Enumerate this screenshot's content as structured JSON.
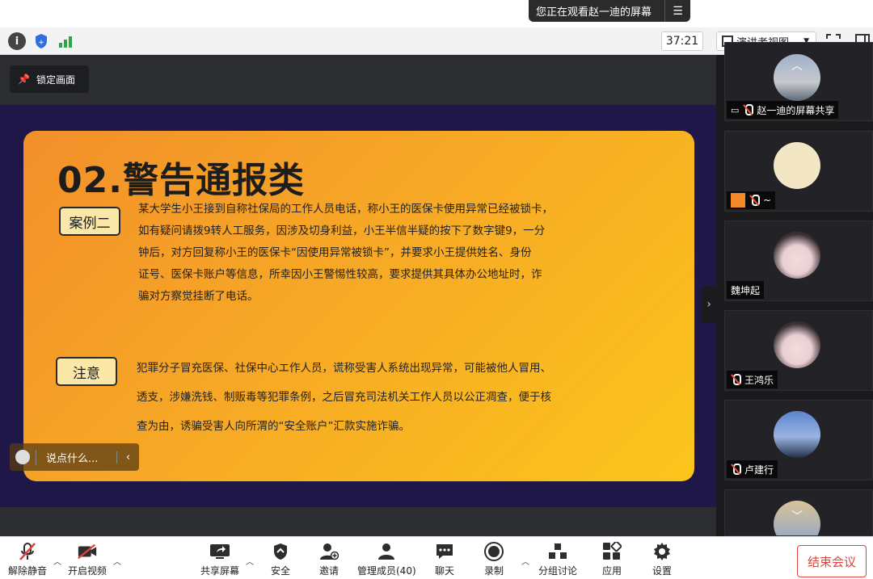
{
  "banner": {
    "watching_text": "您正在观看赵一迪的屏幕",
    "menu_icon": "list-menu-icon"
  },
  "topbar": {
    "timer": "37:21",
    "view_mode": "演讲者视图"
  },
  "stage": {
    "lock_label": "锁定画面"
  },
  "slide": {
    "title": "02.警告通报类",
    "case_tag": "案例二",
    "case_lines": [
      "某大学生小王接到自称社保局的工作人员电话，称小王的医保卡使用异常已经被锁卡，",
      "如有疑问请拨9转人工服务，因涉及切身利益，小王半信半疑的按下了数字键9，一分",
      "钟后，对方回复称小王的医保卡“因使用异常被锁卡”，并要求小王提供姓名、身份",
      "证号、医保卡账户等信息，所幸因小王警惕性较高，要求提供其具体办公地址时，诈",
      "骗对方察觉挂断了电话。"
    ],
    "note_tag": "注意",
    "note_lines": [
      "犯罪分子冒充医保、社保中心エ作人员，谎称受害人系统出现异常，可能被他人冒用、",
      "透支，涉嫌洗钱、制贩毒等犯罪条例，之后冒充司法机关工作人员以公正凋查，便于核",
      "查为由，诱骗受害人向所渭的“安全账户”汇款实施诈骗。"
    ]
  },
  "chat": {
    "placeholder": "说点什么..."
  },
  "participants": [
    {
      "name": "赵一迪的屏幕共享",
      "color": "#8aa0b8"
    },
    {
      "name": "~",
      "color": "#f2e6c4"
    },
    {
      "name": "魏坤起",
      "color": "#e9dfe4"
    },
    {
      "name": "王鸿乐",
      "color": "#e9dfe4"
    },
    {
      "name": "卢建行",
      "color": "#4a6fb0"
    }
  ],
  "toolbar": {
    "unmute": "解除静音",
    "start_video": "开启视频",
    "share": "共享屏幕",
    "security": "安全",
    "invite": "邀请",
    "participants": "管理成员(40)",
    "chat": "聊天",
    "record": "录制",
    "breakout": "分组讨论",
    "apps": "应用",
    "settings": "设置",
    "end": "结束会议"
  }
}
